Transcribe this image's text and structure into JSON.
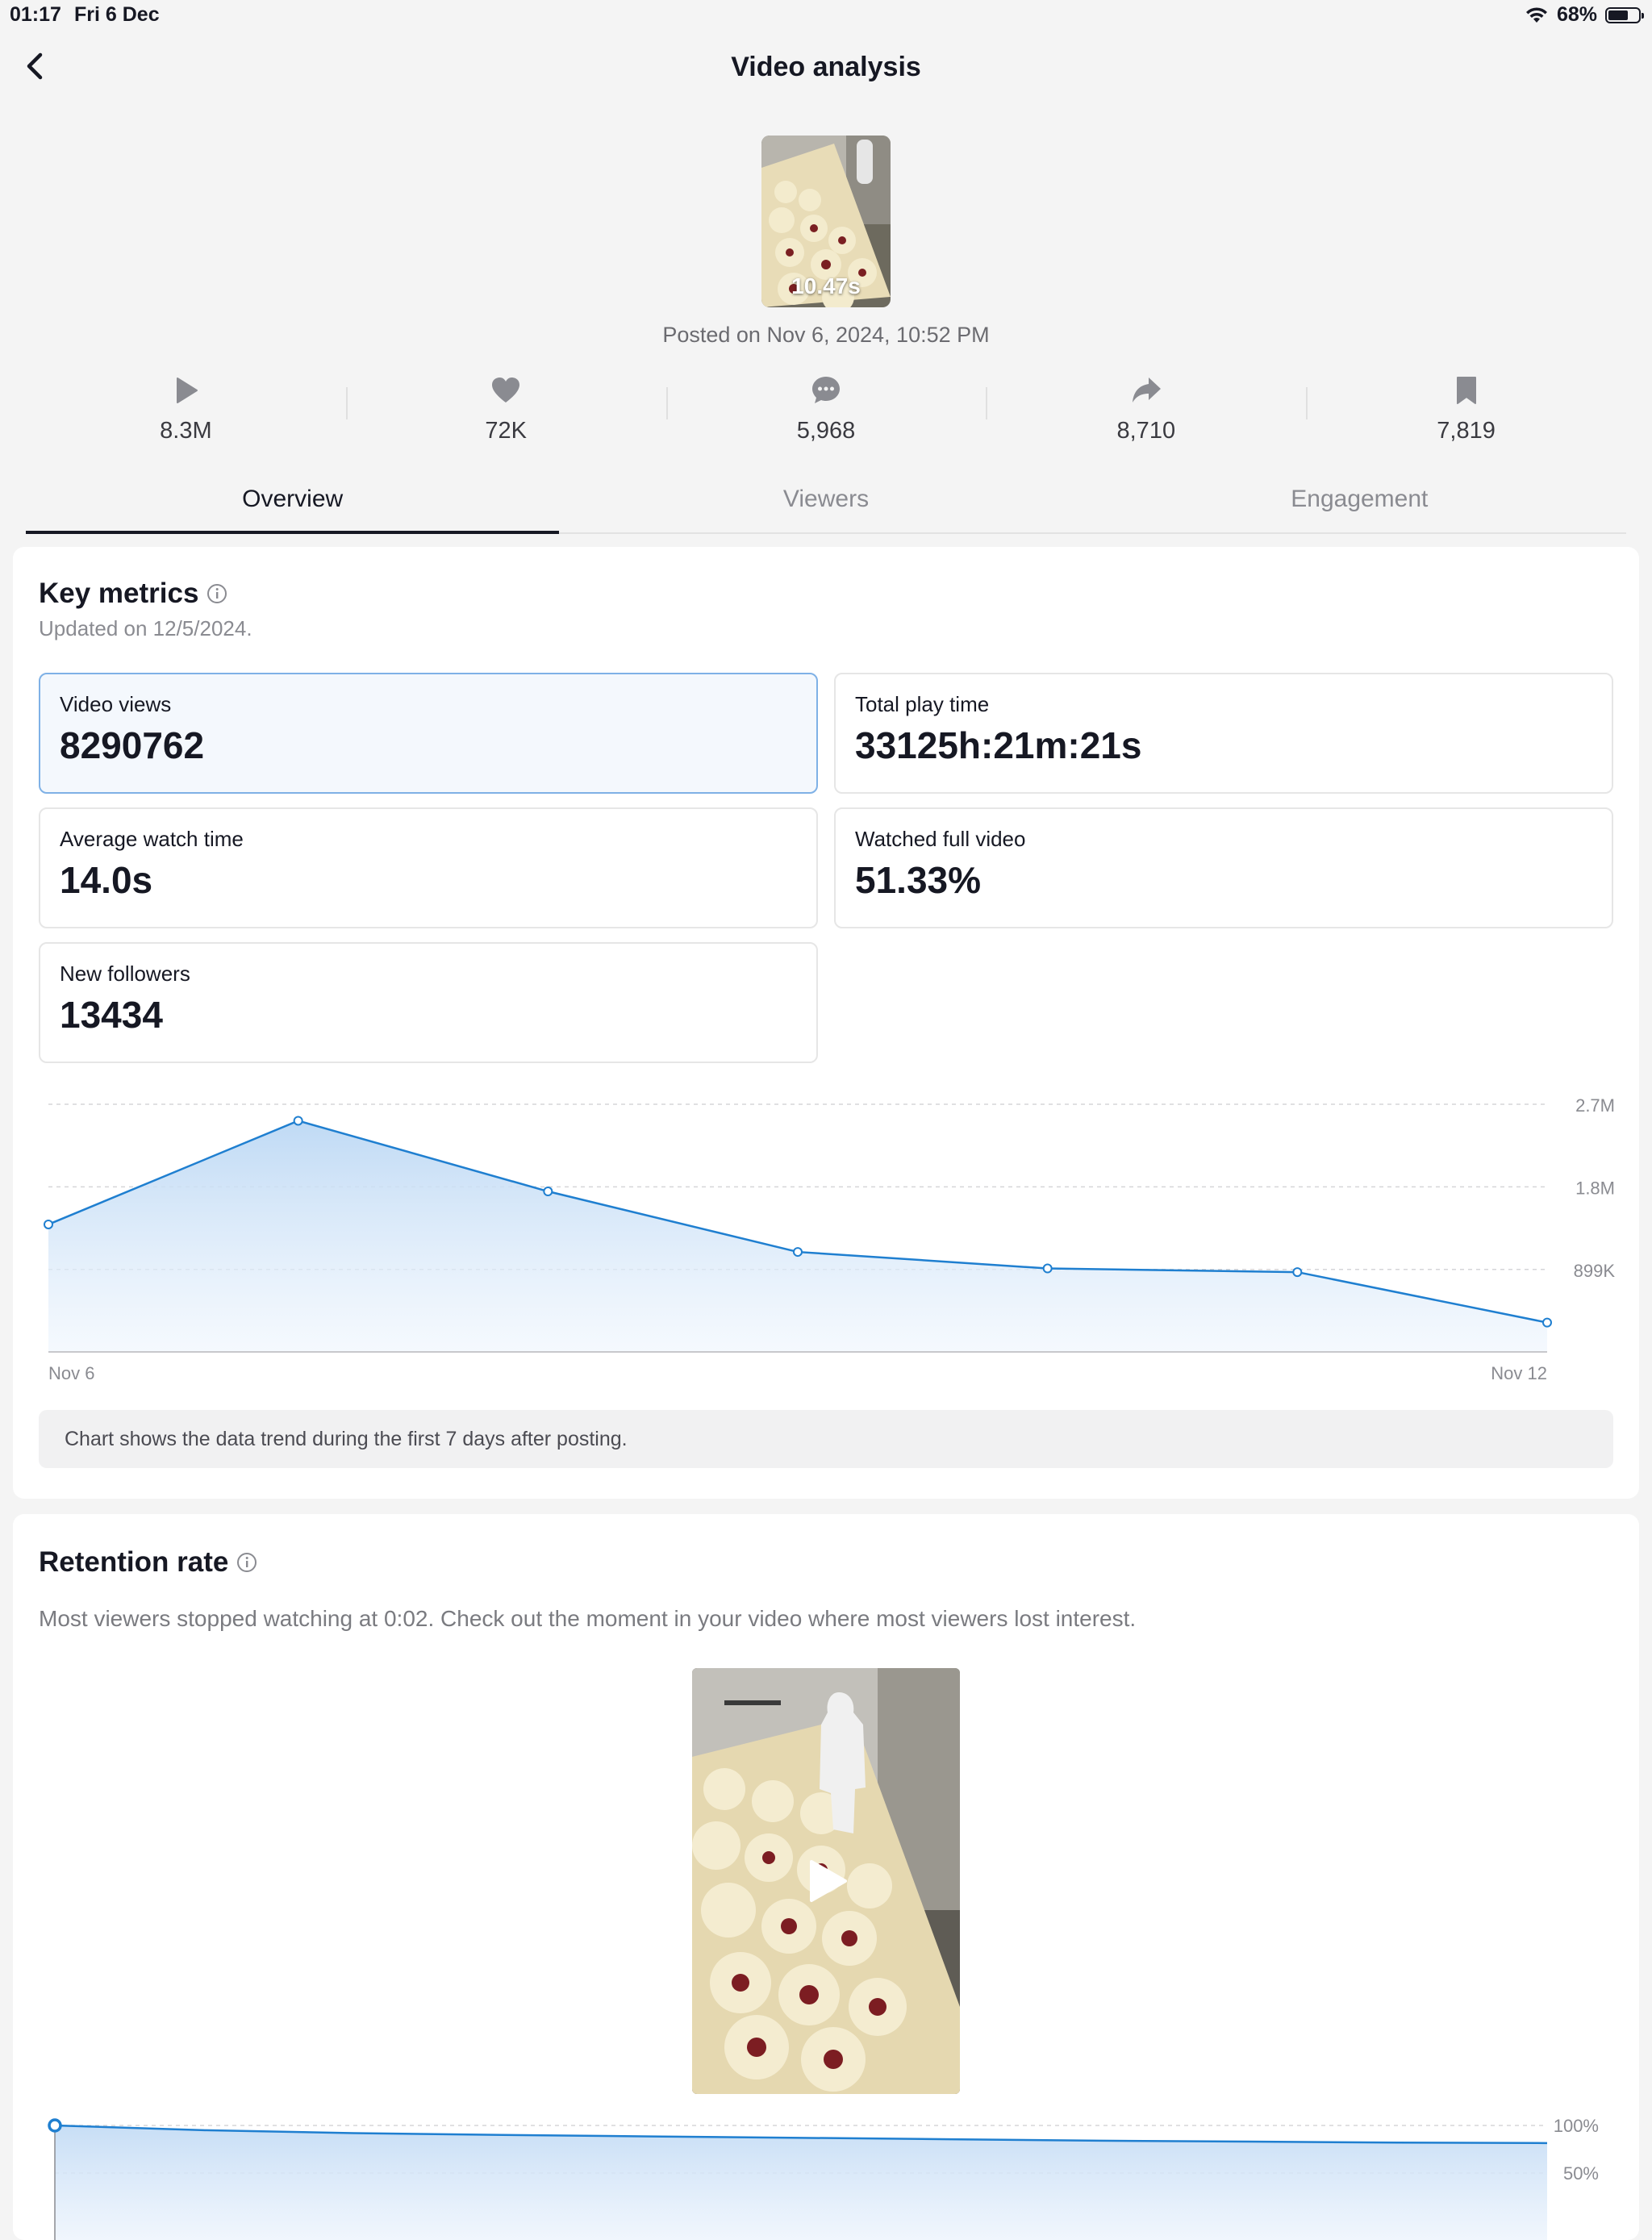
{
  "status_bar": {
    "time": "01:17",
    "date": "Fri 6 Dec",
    "battery_text": "68%",
    "battery_level": 0.68
  },
  "header": {
    "title": "Video analysis"
  },
  "video": {
    "duration": "10.47s",
    "posted": "Posted on Nov 6, 2024, 10:52 PM"
  },
  "stats": [
    {
      "icon": "play-icon",
      "value": "8.3M"
    },
    {
      "icon": "heart-icon",
      "value": "72K"
    },
    {
      "icon": "comment-icon",
      "value": "5,968"
    },
    {
      "icon": "share-icon",
      "value": "8,710"
    },
    {
      "icon": "bookmark-icon",
      "value": "7,819"
    }
  ],
  "tabs": [
    {
      "label": "Overview",
      "active": true
    },
    {
      "label": "Viewers",
      "active": false
    },
    {
      "label": "Engagement",
      "active": false
    }
  ],
  "key_metrics": {
    "title": "Key metrics",
    "updated": "Updated on 12/5/2024.",
    "metrics": [
      {
        "label": "Video views",
        "value": "8290762",
        "selected": true
      },
      {
        "label": "Total play time",
        "value": "33125h:21m:21s",
        "selected": false
      },
      {
        "label": "Average watch time",
        "value": "14.0s",
        "selected": false
      },
      {
        "label": "Watched full video",
        "value": "51.33%",
        "selected": false
      },
      {
        "label": "New followers",
        "value": "13434",
        "selected": false
      }
    ],
    "chart_note": "Chart shows the data trend during the first 7 days after posting."
  },
  "retention": {
    "title": "Retention rate",
    "description": "Most viewers stopped watching at 0:02. Check out the moment in your video where most viewers lost interest."
  },
  "colors": {
    "accent": "#1f7fd0",
    "text": "#161823",
    "muted": "#8a8b91"
  },
  "chart_data": [
    {
      "type": "area",
      "title": "",
      "xlabel": "",
      "ylabel": "",
      "x": [
        "Nov 6",
        "Nov 7",
        "Nov 8",
        "Nov 9",
        "Nov 10",
        "Nov 11",
        "Nov 12"
      ],
      "x_tick_labels": [
        "Nov 6",
        "Nov 12"
      ],
      "values": [
        1390000,
        2520000,
        1750000,
        1090000,
        910000,
        870000,
        320000
      ],
      "y_ticks": [
        {
          "value": 899000,
          "label": "899K"
        },
        {
          "value": 1800000,
          "label": "1.8M"
        },
        {
          "value": 2700000,
          "label": "2.7M"
        }
      ],
      "ylim": [
        0,
        2700000
      ],
      "grid": true,
      "legend": "none"
    },
    {
      "type": "area",
      "title": "",
      "xlabel": "",
      "ylabel": "",
      "values_percent": [
        100,
        95,
        92,
        90,
        88.5,
        87,
        85.5,
        84,
        83,
        82,
        81.5
      ],
      "y_ticks": [
        {
          "value": 100,
          "label": "100%"
        },
        {
          "value": 50,
          "label": "50%"
        }
      ],
      "ylim": [
        0,
        100
      ],
      "grid": true,
      "legend": "none"
    }
  ]
}
